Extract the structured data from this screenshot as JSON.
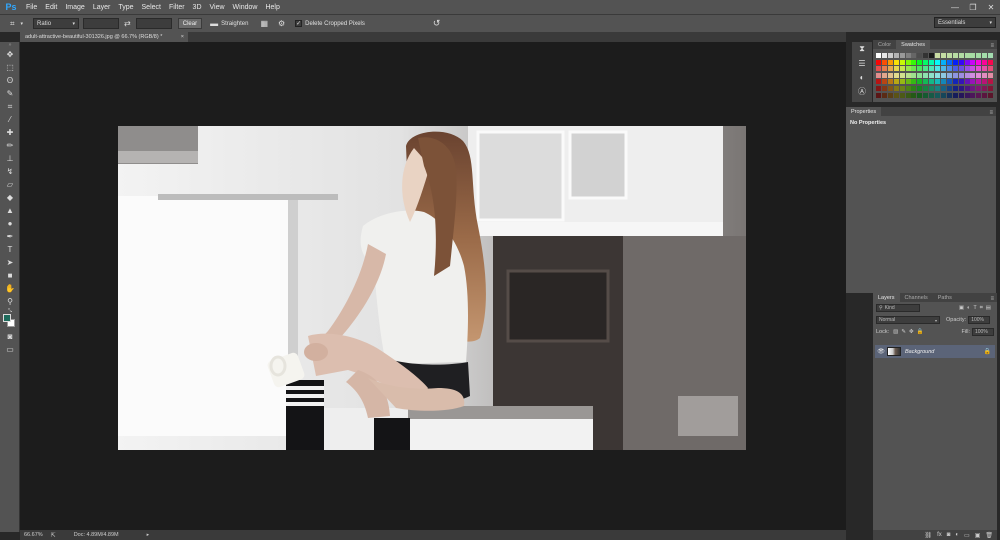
{
  "app": {
    "logo": "Ps"
  },
  "menu": [
    "File",
    "Edit",
    "Image",
    "Layer",
    "Type",
    "Select",
    "Filter",
    "3D",
    "View",
    "Window",
    "Help"
  ],
  "window_controls": {
    "minimize": "—",
    "restore": "❐",
    "close": "✕"
  },
  "options": {
    "ratio": "Ratio",
    "clear": "Clear",
    "straighten": "Straighten",
    "delete_cropped": "Delete Cropped Pixels",
    "delete_checked": "✓",
    "workspace": "Essentials"
  },
  "document": {
    "tab_title": "adult-attractive-beautiful-301326.jpg @ 66.7% (RGB/8) *",
    "close": "×"
  },
  "status": {
    "zoom": "66.67%",
    "doc": "Doc: 4.89M/4.89M"
  },
  "panels": {
    "color_tab": "Color",
    "swatches_tab": "Swatches",
    "properties_tab": "Properties",
    "no_properties": "No Properties",
    "layers_tab": "Layers",
    "channels_tab": "Channels",
    "paths_tab": "Paths"
  },
  "layers": {
    "kind": "Kind",
    "mode": "Normal",
    "opacity_label": "Opacity:",
    "opacity": "100%",
    "lock_label": "Lock:",
    "fill_label": "Fill:",
    "fill": "100%",
    "items": [
      {
        "name": "Background"
      }
    ]
  },
  "colors": {
    "foreground": "#1e6b5c",
    "background": "#ffffff"
  }
}
